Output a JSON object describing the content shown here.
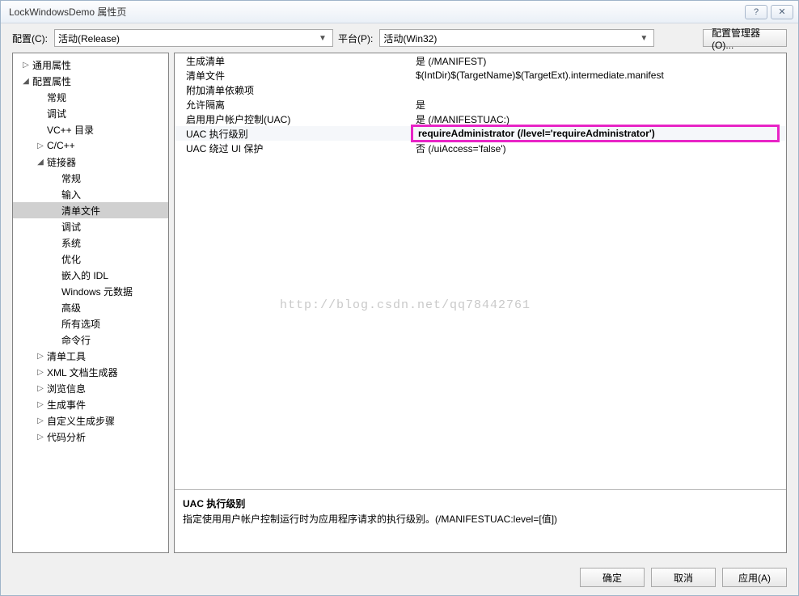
{
  "window": {
    "title": "LockWindowsDemo 属性页"
  },
  "toolbar": {
    "config_label": "配置(C):",
    "config_value": "活动(Release)",
    "platform_label": "平台(P):",
    "platform_value": "活动(Win32)",
    "config_manager_label": "配置管理器(O)..."
  },
  "tree": [
    {
      "label": "通用属性",
      "depth": 0,
      "exp": "▷"
    },
    {
      "label": "配置属性",
      "depth": 0,
      "exp": "◢"
    },
    {
      "label": "常规",
      "depth": 1,
      "exp": ""
    },
    {
      "label": "调试",
      "depth": 1,
      "exp": ""
    },
    {
      "label": "VC++ 目录",
      "depth": 1,
      "exp": ""
    },
    {
      "label": "C/C++",
      "depth": 1,
      "exp": "▷"
    },
    {
      "label": "链接器",
      "depth": 1,
      "exp": "◢"
    },
    {
      "label": "常规",
      "depth": 2,
      "exp": ""
    },
    {
      "label": "输入",
      "depth": 2,
      "exp": ""
    },
    {
      "label": "清单文件",
      "depth": 2,
      "exp": "",
      "selected": true
    },
    {
      "label": "调试",
      "depth": 2,
      "exp": ""
    },
    {
      "label": "系统",
      "depth": 2,
      "exp": ""
    },
    {
      "label": "优化",
      "depth": 2,
      "exp": ""
    },
    {
      "label": "嵌入的 IDL",
      "depth": 2,
      "exp": ""
    },
    {
      "label": "Windows 元数据",
      "depth": 2,
      "exp": ""
    },
    {
      "label": "高级",
      "depth": 2,
      "exp": ""
    },
    {
      "label": "所有选项",
      "depth": 2,
      "exp": ""
    },
    {
      "label": "命令行",
      "depth": 2,
      "exp": ""
    },
    {
      "label": "清单工具",
      "depth": 1,
      "exp": "▷"
    },
    {
      "label": "XML 文档生成器",
      "depth": 1,
      "exp": "▷"
    },
    {
      "label": "浏览信息",
      "depth": 1,
      "exp": "▷"
    },
    {
      "label": "生成事件",
      "depth": 1,
      "exp": "▷"
    },
    {
      "label": "自定义生成步骤",
      "depth": 1,
      "exp": "▷"
    },
    {
      "label": "代码分析",
      "depth": 1,
      "exp": "▷"
    }
  ],
  "props": [
    {
      "name": "生成清单",
      "value": "是 (/MANIFEST)"
    },
    {
      "name": "清单文件",
      "value": "$(IntDir)$(TargetName)$(TargetExt).intermediate.manifest"
    },
    {
      "name": "附加清单依赖项",
      "value": ""
    },
    {
      "name": "允许隔离",
      "value": "是"
    },
    {
      "name": "启用用户帐户控制(UAC)",
      "value": "是 (/MANIFESTUAC:)"
    },
    {
      "name": "UAC 执行级别",
      "value": "requireAdministrator (/level='requireAdministrator')",
      "highlight": true
    },
    {
      "name": "UAC 绕过 UI 保护",
      "value": "否 (/uiAccess='false')"
    }
  ],
  "desc": {
    "title": "UAC 执行级别",
    "text": "指定使用用户帐户控制运行时为应用程序请求的执行级别。(/MANIFESTUAC:level=[值])"
  },
  "footer": {
    "ok": "确定",
    "cancel": "取消",
    "apply": "应用(A)"
  },
  "watermark": "http://blog.csdn.net/qq78442761"
}
